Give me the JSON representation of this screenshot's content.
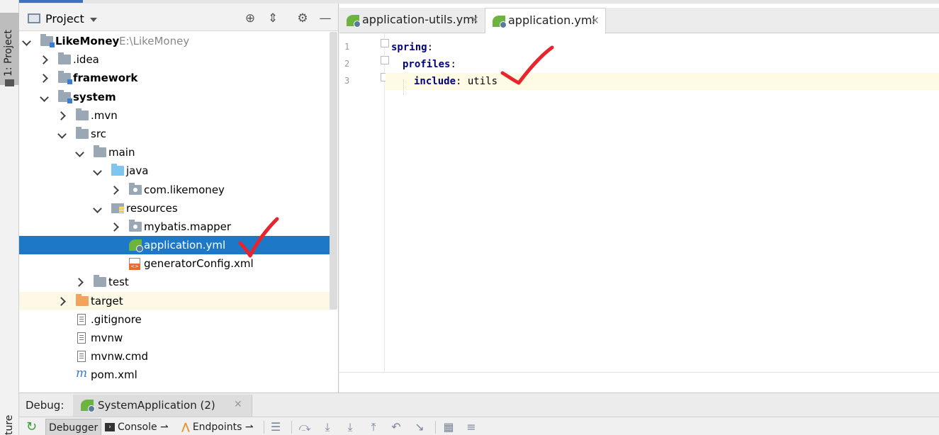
{
  "stripe": {
    "project_tab": "1: Project",
    "structure_tab": "ture"
  },
  "project_panel": {
    "title": "Project",
    "tree": {
      "root": {
        "label": "LikeMoney",
        "path": "E:\\LikeMoney"
      },
      "idea": ".idea",
      "framework": "framework",
      "system": "system",
      "mvn": ".mvn",
      "src": "src",
      "main": "main",
      "java": "java",
      "pkg": "com.likemoney",
      "resources": "resources",
      "mybatis": "mybatis.mapper",
      "application": "application.yml",
      "generator": "generatorConfig.xml",
      "test": "test",
      "target": "target",
      "gitignore": ".gitignore",
      "mvnw": "mvnw",
      "mvnwcmd": "mvnw.cmd",
      "pom": "pom.xml"
    }
  },
  "editor": {
    "tabs": [
      {
        "label": "application-utils.yml"
      },
      {
        "label": "application.yml"
      }
    ],
    "lines": [
      {
        "number": "1",
        "key": "spring",
        "value": ""
      },
      {
        "number": "2",
        "key": "profiles",
        "value": ""
      },
      {
        "number": "3",
        "key": "include",
        "value": "utils"
      }
    ]
  },
  "debug": {
    "label": "Debug:",
    "session": "SystemApplication (2)",
    "subtabs": {
      "debugger": "Debugger",
      "console": "Console",
      "endpoints": "Endpoints"
    }
  },
  "colors": {
    "selection": "#1e78c8",
    "check_mark": "#e8242c",
    "yaml_key": "#000080",
    "spring_green": "#6db33f"
  }
}
